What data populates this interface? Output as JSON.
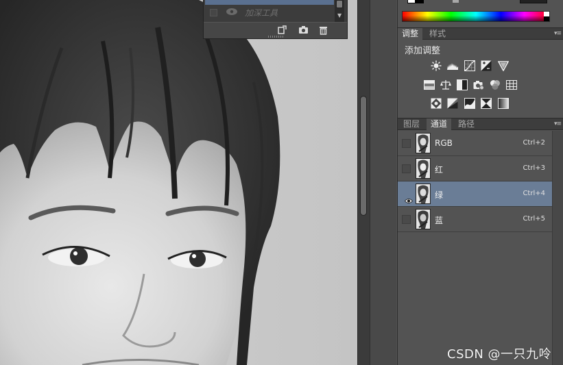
{
  "history_panel": {
    "tool_label": "加深工具",
    "footer_icons": [
      "new-document-icon",
      "camera-icon",
      "trash-icon"
    ]
  },
  "adjustments_panel": {
    "tabs": [
      {
        "label": "调整",
        "active": true
      },
      {
        "label": "样式",
        "active": false
      }
    ],
    "title": "添加调整",
    "icon_rows": [
      [
        "brightness-icon",
        "levels-icon",
        "curves-icon",
        "exposure-icon",
        "vibrance-icon"
      ],
      [
        "hue-saturation-icon",
        "color-balance-icon",
        "black-white-icon",
        "photo-filter-icon",
        "channel-mixer-icon",
        "color-lookup-icon"
      ],
      [
        "invert-icon",
        "posterize-icon",
        "threshold-icon",
        "selective-color-icon",
        "gradient-map-icon"
      ]
    ]
  },
  "channels_panel": {
    "tabs": [
      {
        "label": "图层",
        "active": false
      },
      {
        "label": "通道",
        "active": true
      },
      {
        "label": "路径",
        "active": false
      }
    ],
    "channels": [
      {
        "name": "RGB",
        "shortcut": "Ctrl+2",
        "visible": false,
        "selected": false
      },
      {
        "name": "红",
        "shortcut": "Ctrl+3",
        "visible": false,
        "selected": false
      },
      {
        "name": "绿",
        "shortcut": "Ctrl+4",
        "visible": true,
        "selected": true
      },
      {
        "name": "蓝",
        "shortcut": "Ctrl+5",
        "visible": false,
        "selected": false
      }
    ]
  },
  "watermark": "CSDN @一只九呤",
  "colors": {
    "dock_bg": "#535353",
    "selected_row": "#6a7d96",
    "tabbar_bg": "#3d3d3d"
  }
}
